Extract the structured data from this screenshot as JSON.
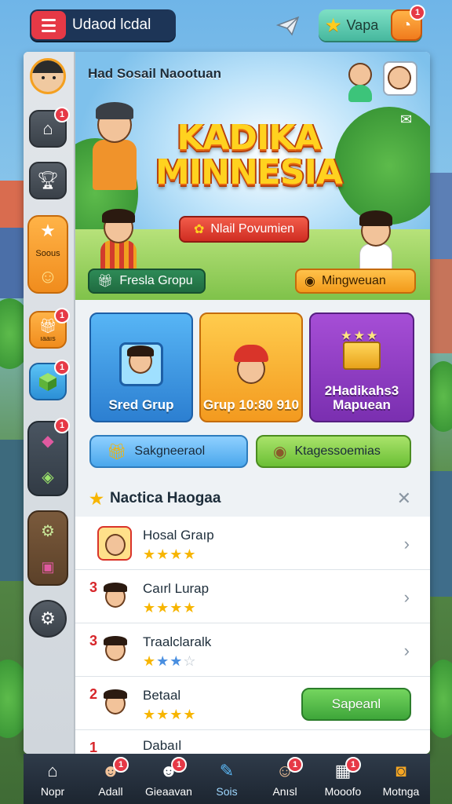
{
  "topbar": {
    "title": "Udaod lcdal",
    "currency_label": "Vapa",
    "currency_badge": "1"
  },
  "sidebar": {
    "home_badge": "1",
    "group_label": "Soous",
    "gift_badge": "1",
    "gift_label": "ıaaıs",
    "cube_badge": "1",
    "tag_badge": "1"
  },
  "banner": {
    "top_label": "Had Sosail Naootuan",
    "title_line1": "KADIKA",
    "title_line2": "MINNESIA",
    "cta_label": "Nlail Povumien",
    "left_button": "Fresla Gropu",
    "right_button": "Mingweuan"
  },
  "cards": [
    {
      "label": "Sred Grup"
    },
    {
      "label": "Grup 10:80 910"
    },
    {
      "label": "2Hadikahs3 Mapuean"
    }
  ],
  "actions": {
    "blue_button": "Sakgneeraol",
    "green_button": "Ktagessoemias"
  },
  "list": {
    "header": "Nactica Haogaa",
    "rows": [
      {
        "rank": "",
        "name": "Hosal Graıp",
        "stars": 4,
        "blue": 0
      },
      {
        "rank": "3",
        "name": "Caırl Lurap",
        "stars": 4,
        "blue": 0
      },
      {
        "rank": "3",
        "name": "Traalclaralk",
        "stars": 1,
        "blue": 2
      },
      {
        "rank": "2",
        "name": "Betaal",
        "stars": 4,
        "blue": 0,
        "button": "Sapeanl"
      },
      {
        "rank": "1",
        "name": "Dabaıl",
        "stars": 0,
        "blue": 0
      }
    ]
  },
  "bottomnav": [
    {
      "label": "Nopr",
      "icon": "home-icon"
    },
    {
      "label": "Adall",
      "icon": "avatar-icon",
      "badge": "1"
    },
    {
      "label": "Gieaavan",
      "icon": "people-icon",
      "badge": "1"
    },
    {
      "label": "Sois",
      "icon": "chat-icon"
    },
    {
      "label": "Anısl",
      "icon": "kid-icon",
      "badge": "1"
    },
    {
      "label": "Mooofo",
      "icon": "shop-icon",
      "badge": "1"
    },
    {
      "label": "Motnga",
      "icon": "map-icon"
    }
  ],
  "colors": {
    "accent_red": "#e63946",
    "accent_orange": "#f39a1f",
    "accent_green": "#3ea63a",
    "accent_blue": "#2c7fd1",
    "accent_purple": "#7a2fb0"
  }
}
